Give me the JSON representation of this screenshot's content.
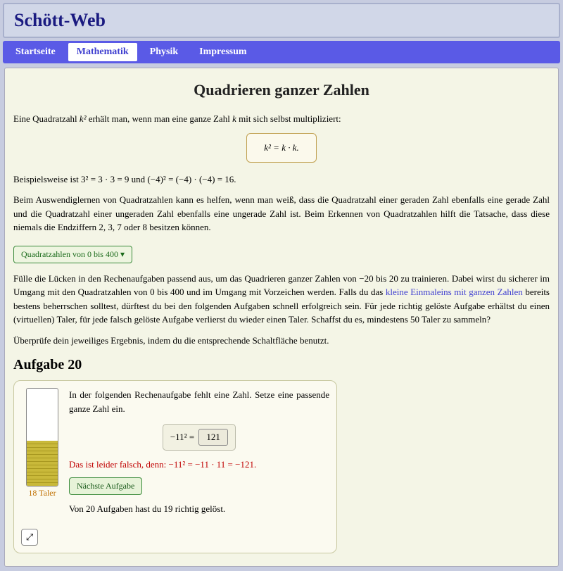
{
  "site": {
    "title": "Schött-Web"
  },
  "nav": {
    "items": [
      {
        "label": "Startseite"
      },
      {
        "label": "Mathematik"
      },
      {
        "label": "Physik"
      },
      {
        "label": "Impressum"
      }
    ],
    "active_index": 1
  },
  "page": {
    "title": "Quadrieren ganzer Zahlen",
    "intro_pre": "Eine Quadratzahl ",
    "intro_post": " erhält man, wenn man eine ganze Zahl ",
    "intro_tail": " mit sich selbst multipliziert:",
    "formula": "k² = k · k.",
    "example_pre": "Beispielsweise ist ",
    "example_mid": "3² = 3 · 3 = 9 und (−4)² = (−4) · (−4) = 16.",
    "memorize_text": "Beim Aus­wen­dig­ler­nen von Qua­drat­zahlen kann es helfen, wenn man weiß, dass die Qua­drat­zahl einer geraden Zahl eben­falls eine gerade Zahl und die Qua­drat­zahl ei­ner ungeraden Zahl eben­falls eine ungerade Zahl ist. Beim Erkennen von Qua­drat­zahlen hilft die Tat­sache, dass diese niemals die End­zif­fern 2, 3, 7 oder 8 besitzen kön­nen.",
    "collapse_label": "Quadratzahlen von 0 bis 400 ▾",
    "instructions_a": "Fülle die Lücken in den Rechen­auf­gaben passend aus, um das Quadrieren ganzer Zahlen von −20 bis 20 zu trainieren. Dabei wirst du sicherer im Umgang mit den Qua­drat­zahlen von 0 bis 400 und im Umgang mit Vor­zeichen werden. Falls du das ",
    "instructions_link": "kleine Ein­mal­eins mit ganzen Zahlen",
    "instructions_b": " bereits bestens beherrschen solltest, dürftest du bei den folgenden Aufgaben schnell erfolgreich sein. Für jede richtig gelöste Aufgabe erhältst du einen (virtuellen) Taler, für jede falsch gelöste Aufgabe verlierst du wieder einen Taler. Schaffst du es, mindestens 50 Taler zu sammeln?",
    "check_text": "Über­prüfe dein jeweiliges Ergebnis, indem du die ent­sprechende Schalt­fläche benutzt."
  },
  "exercise": {
    "heading": "Aufgabe 20",
    "prompt": "In der folgenden Rechen­aufgabe fehlt eine Zahl. Setze eine passende ganze Zahl ein.",
    "lhs": "−11² = ",
    "input_value": "121",
    "feedback": "Das ist leider falsch, denn: −11² = −11 · 11 = −121.",
    "next_label": "Nächste Aufgabe",
    "progress": "Von 20 Aufgaben hast du 19 richtig gelöst.",
    "coin_label": "18 Taler"
  }
}
